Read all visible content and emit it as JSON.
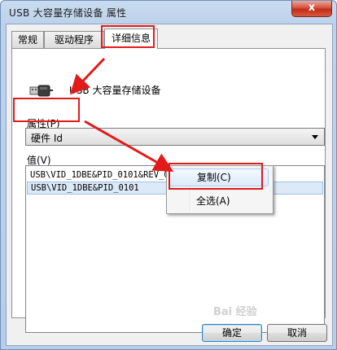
{
  "window": {
    "title": "USB 大容量存储设备 属性",
    "close_label": "x"
  },
  "tabs": [
    {
      "label": "常规",
      "active": false
    },
    {
      "label": "驱动程序",
      "active": false
    },
    {
      "label": "详细信息",
      "active": true
    }
  ],
  "device": {
    "name": "USB 大容量存储设备",
    "icon": "usb-plug-icon"
  },
  "property": {
    "label": "属性(P)",
    "selected": "硬件 Id"
  },
  "values": {
    "label": "值(V)",
    "items": [
      {
        "text": "USB\\VID_1DBE&PID_0101&REV_0106",
        "selected": false
      },
      {
        "text": "USB\\VID_1DBE&PID_0101",
        "selected": true
      }
    ]
  },
  "context_menu": {
    "items": [
      {
        "label": "复制(C)"
      },
      {
        "label": "全选(A)"
      }
    ]
  },
  "buttons": {
    "ok": "确定",
    "cancel": "取消"
  },
  "annotation_color": "#e21a1a",
  "watermark": "Bai 经验"
}
